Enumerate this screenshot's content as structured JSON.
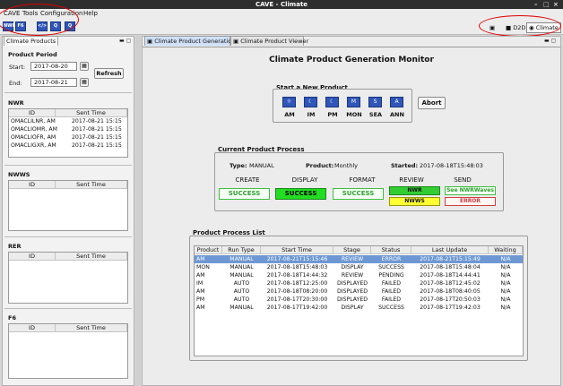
{
  "window": {
    "title": "CAVE - Climate",
    "minimize": "–",
    "maximize": "□",
    "close": "×"
  },
  "menu": [
    "CAVE",
    "Tools",
    "Configuration",
    "Help"
  ],
  "toolbar": {
    "icons": [
      {
        "name": "climate-icon",
        "label": "NWR"
      },
      {
        "name": "f6-icon",
        "label": "F6"
      },
      {
        "name": "code-icon",
        "label": "</>"
      },
      {
        "name": "q-icon",
        "label": "Q"
      },
      {
        "name": "flag-icon",
        "label": "Q"
      }
    ],
    "perspective_d2d": "D2D",
    "perspective_climate": "Climate"
  },
  "left": {
    "tab": "Climate Products",
    "product_period": "Product Period",
    "start_label": "Start:",
    "start_value": "2017-08-20",
    "end_label": "End:",
    "end_value": "2017-08-21",
    "refresh": "Refresh",
    "sections": [
      {
        "title": "NWR",
        "col_id": "ID",
        "col_time": "Sent Time",
        "rows": [
          {
            "id": "OMACLILNR, AM",
            "time": "2017-08-21 15:15"
          },
          {
            "id": "OMACLIOMR, AM",
            "time": "2017-08-21 15:15"
          },
          {
            "id": "OMACLIOFR, AM",
            "time": "2017-08-21 15:15"
          },
          {
            "id": "OMACLIGXR, AM",
            "time": "2017-08-21 15:15"
          }
        ]
      },
      {
        "title": "NWWS",
        "col_id": "ID",
        "col_time": "Sent Time",
        "rows": []
      },
      {
        "title": "RER",
        "col_id": "ID",
        "col_time": "Sent Time",
        "rows": []
      },
      {
        "title": "F6",
        "col_id": "ID",
        "col_time": "Sent Time",
        "rows": []
      }
    ]
  },
  "tabs": {
    "generation": "Climate Product Generation",
    "viewer": "Climate Product Viewer"
  },
  "main": {
    "title": "Climate Product Generation Monitor",
    "start_new": "Start a New Product",
    "products": [
      {
        "label": "AM",
        "glyph": "☼"
      },
      {
        "label": "IM",
        "glyph": "☾"
      },
      {
        "label": "PM",
        "glyph": "☾"
      },
      {
        "label": "MON",
        "glyph": "M"
      },
      {
        "label": "SEA",
        "glyph": "S"
      },
      {
        "label": "ANN",
        "glyph": "A"
      }
    ],
    "abort": "Abort",
    "current": {
      "title": "Current Product Process",
      "type_label": "Type:",
      "type_value": "MANUAL",
      "product_label": "Product:",
      "product_value": "Monthly",
      "started_label": "Started:",
      "started_value": "2017-08-18T15:48:03",
      "stages": [
        "CREATE",
        "DISPLAY",
        "FORMAT",
        "REVIEW",
        "SEND"
      ],
      "create": "SUCCESS",
      "display": "SUCCESS",
      "format": "SUCCESS",
      "review_nwr": "NWR",
      "review_nwws": "NWWS",
      "send_nwr": "See NWRWaves",
      "send_error": "ERROR"
    },
    "list": {
      "title": "Product Process List",
      "columns": [
        "Product",
        "Run Type",
        "Start Time",
        "Stage",
        "Status",
        "Last Update",
        "Waiting"
      ],
      "rows": [
        [
          "AM",
          "MANUAL",
          "2017-08-21T15:15:46",
          "REVIEW",
          "ERROR",
          "2017-08-21T15:15:49",
          "N/A"
        ],
        [
          "MON",
          "MANUAL",
          "2017-08-18T15:48:03",
          "DISPLAY",
          "SUCCESS",
          "2017-08-18T15:48:04",
          "N/A"
        ],
        [
          "AM",
          "MANUAL",
          "2017-08-18T14:44:32",
          "REVIEW",
          "PENDING",
          "2017-08-18T14:44:41",
          "N/A"
        ],
        [
          "IM",
          "AUTO",
          "2017-08-18T12:25:00",
          "DISPLAYED",
          "FAILED",
          "2017-08-18T12:45:02",
          "N/A"
        ],
        [
          "AM",
          "AUTO",
          "2017-08-18T08:20:00",
          "DISPLAYED",
          "FAILED",
          "2017-08-18T08:40:05",
          "N/A"
        ],
        [
          "PM",
          "AUTO",
          "2017-08-17T20:30:00",
          "DISPLAYED",
          "FAILED",
          "2017-08-17T20:50:03",
          "N/A"
        ],
        [
          "AM",
          "MANUAL",
          "2017-08-17T19:42:00",
          "DISPLAY",
          "SUCCESS",
          "2017-08-17T19:42:03",
          "N/A"
        ]
      ]
    }
  },
  "colors": {
    "selected_row": "#6e98d3",
    "success_green": "#2fd22f",
    "nwr_green": "#33cc33",
    "nwws_yellow": "#ffff33",
    "error_red": "#d04040"
  }
}
